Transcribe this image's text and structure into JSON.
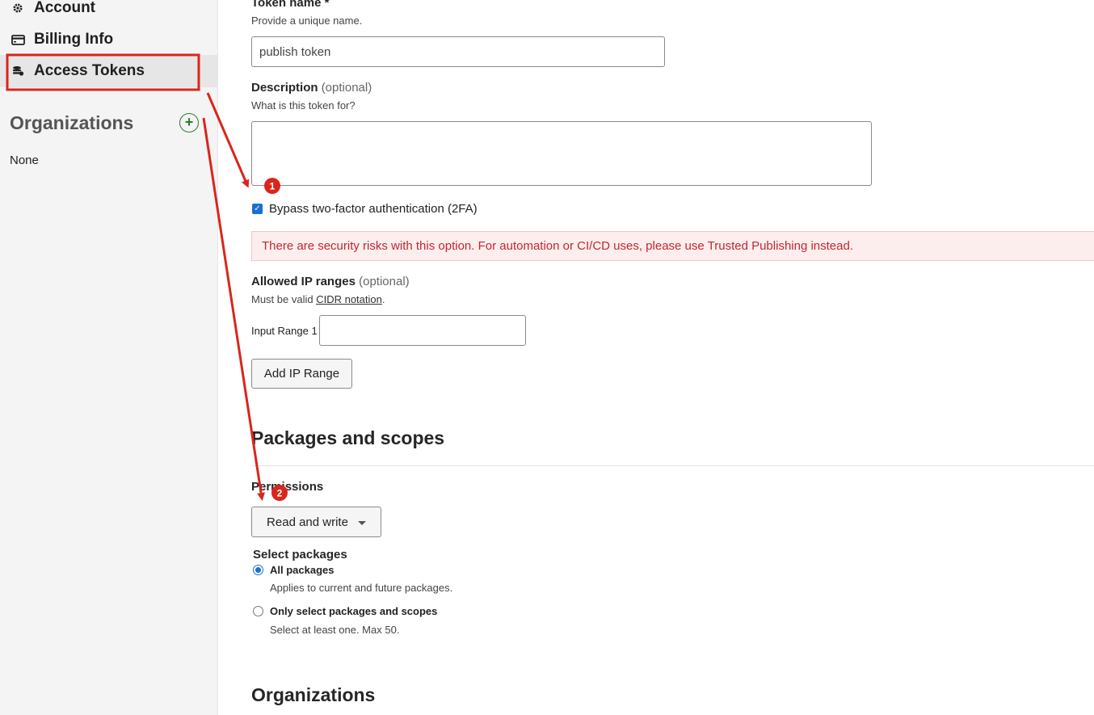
{
  "sidebar": {
    "items": [
      {
        "label": "Account",
        "icon": "gear-icon"
      },
      {
        "label": "Billing Info",
        "icon": "credit-card-icon"
      },
      {
        "label": "Access Tokens",
        "icon": "tokens-icon",
        "active": true
      }
    ],
    "organizations_heading": "Organizations",
    "organizations_add_icon": "plus-circle-icon",
    "organizations_value": "None"
  },
  "form": {
    "token_name": {
      "label": "Token name *",
      "hint": "Provide a unique name.",
      "value": "publish token"
    },
    "description": {
      "label": "Description",
      "optional": "(optional)",
      "hint": "What is this token for?",
      "value": ""
    },
    "bypass_2fa": {
      "label": "Bypass two-factor authentication (2FA)",
      "checked": true
    },
    "warning": "There are security risks with this option. For automation or CI/CD uses, please use Trusted Publishing instead.",
    "ip_ranges": {
      "label": "Allowed IP ranges",
      "optional": "(optional)",
      "hint_prefix": "Must be valid ",
      "hint_link": "CIDR notation",
      "hint_suffix": ".",
      "range_label": "Input Range 1",
      "range_value": "",
      "add_button": "Add IP Range"
    }
  },
  "packages": {
    "heading": "Packages and scopes",
    "permissions_label": "Permissions",
    "permissions_value": "Read and write",
    "select_label": "Select packages",
    "options": [
      {
        "label": "All packages",
        "hint": "Applies to current and future packages.",
        "selected": true
      },
      {
        "label": "Only select packages and scopes",
        "hint": "Select at least one. Max 50.",
        "selected": false
      }
    ]
  },
  "organizations_section": {
    "heading": "Organizations"
  },
  "annotations": {
    "badges": [
      "1",
      "2"
    ],
    "color": "#d9261c"
  }
}
